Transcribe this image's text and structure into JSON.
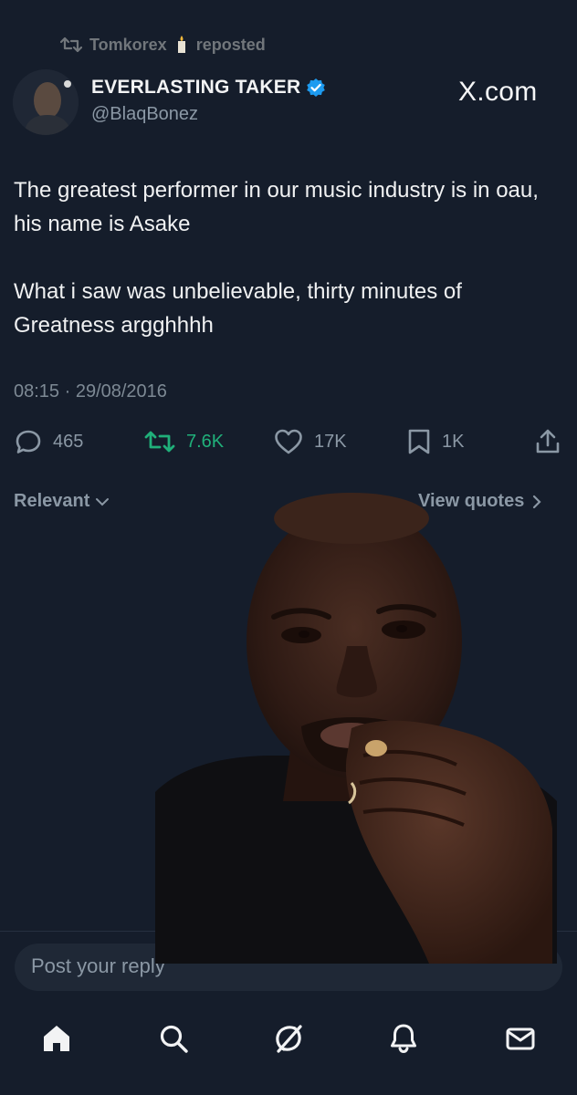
{
  "repost": {
    "reposter": "Tomkorex",
    "label": "reposted"
  },
  "author": {
    "display_name": "EVERLASTING TAKER",
    "handle": "@BlaqBonez",
    "verified": true
  },
  "watermark": "X.com",
  "post": {
    "paragraphs": [
      "The greatest performer in our music industry is in oau, his name is Asake",
      "What i saw was unbelievable, thirty minutes of Greatness argghhhh"
    ],
    "timestamp": "08:15 · 29/08/2016"
  },
  "stats": {
    "replies": "465",
    "reposts": "7.6K",
    "likes": "17K",
    "bookmarks": "1K"
  },
  "filters": {
    "sort_label": "Relevant",
    "quotes_label": "View quotes"
  },
  "reply": {
    "placeholder": "Post your reply"
  },
  "colors": {
    "background": "#151d2b",
    "repost_accent": "#20b07a",
    "verified_badge": "#1d9bf0"
  },
  "nav": [
    "home-icon",
    "search-icon",
    "grok-icon",
    "notifications-icon",
    "messages-icon"
  ]
}
